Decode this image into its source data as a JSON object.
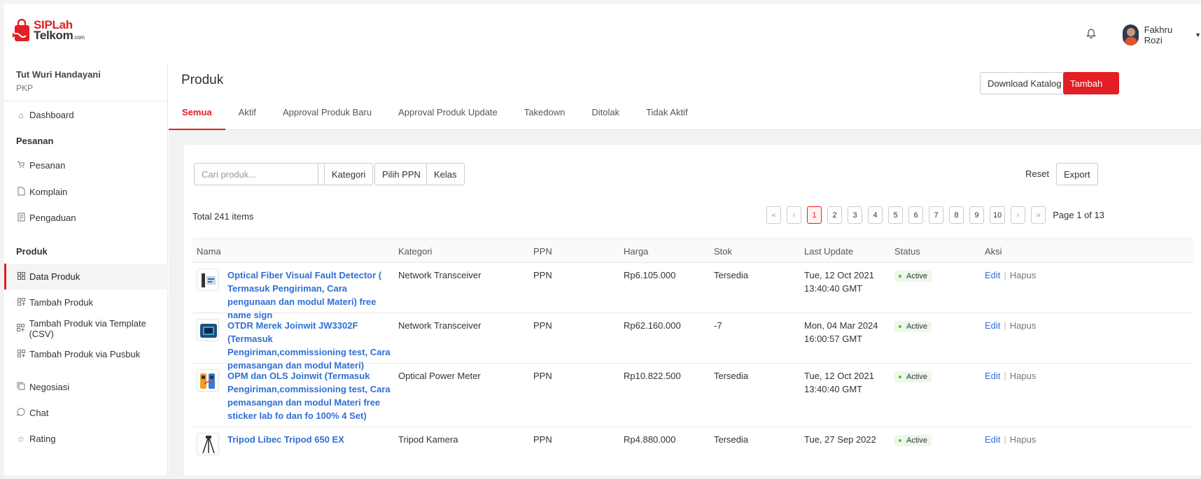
{
  "brand": {
    "line1_a": "SIPLah",
    "line2": "Telkom",
    "line2_small": ".com"
  },
  "header": {
    "user_name": "Fakhru Rozi"
  },
  "sidebar": {
    "org_name": "Tut Wuri Handayani",
    "org_type": "PKP",
    "dashboard": "Dashboard",
    "section_pesanan": "Pesanan",
    "pesanan": "Pesanan",
    "komplain": "Komplain",
    "pengaduan": "Pengaduan",
    "section_produk": "Produk",
    "data_produk": "Data Produk",
    "tambah_produk": "Tambah Produk",
    "tambah_csv": "Tambah Produk via Template (CSV)",
    "tambah_pusbuk": "Tambah Produk via Pusbuk",
    "negosiasi": "Negosiasi",
    "chat": "Chat",
    "rating": "Rating"
  },
  "page": {
    "title": "Produk",
    "download_label": "Download Katalog",
    "add_label": "Tambah",
    "tabs": [
      "Semua",
      "Aktif",
      "Approval Produk Baru",
      "Approval Produk Update",
      "Takedown",
      "Ditolak",
      "Tidak Aktif"
    ]
  },
  "filters": {
    "search_placeholder": "Cari produk...",
    "kategori": "Kategori",
    "ppn": "Pilih PPN",
    "kelas": "Kelas",
    "reset": "Reset",
    "export": "Export"
  },
  "list": {
    "total": "Total 241 items",
    "pages": [
      "«",
      "‹",
      "1",
      "2",
      "3",
      "4",
      "5",
      "6",
      "7",
      "8",
      "9",
      "10",
      "›",
      "»"
    ],
    "current_page": "1",
    "page_info": "Page 1 of 13"
  },
  "table": {
    "headers": [
      "Nama",
      "Kategori",
      "PPN",
      "Harga",
      "Stok",
      "Last Update",
      "Status",
      "Aksi"
    ],
    "edit": "Edit",
    "sep": "|",
    "delete": "Hapus",
    "rows": [
      {
        "name": "Optical Fiber Visual Fault Detector ( Termasuk Pengiriman, Cara pengunaan dan modul Materi) free name sign",
        "kategori": "Network Transceiver",
        "ppn": "PPN",
        "harga": "Rp6.105.000",
        "stok": "Tersedia",
        "update1": "Tue, 12 Oct 2021",
        "update2": "13:40:40 GMT",
        "status": "Active"
      },
      {
        "name": "OTDR Merek Joinwit JW3302F (Termasuk Pengiriman,commissioning test, Cara pemasangan dan modul Materi)",
        "kategori": "Network Transceiver",
        "ppn": "PPN",
        "harga": "Rp62.160.000",
        "stok": "-7",
        "update1": "Mon, 04 Mar 2024",
        "update2": "16:00:57 GMT",
        "status": "Active"
      },
      {
        "name": "OPM dan OLS Joinwit (Termasuk Pengiriman,commissioning test, Cara pemasangan dan modul Materi free sticker lab fo dan fo 100% 4 Set)",
        "kategori": "Optical Power Meter",
        "ppn": "PPN",
        "harga": "Rp10.822.500",
        "stok": "Tersedia",
        "update1": "Tue, 12 Oct 2021",
        "update2": "13:40:40 GMT",
        "status": "Active"
      },
      {
        "name": "Tripod Libec Tripod 650 EX",
        "kategori": "Tripod Kamera",
        "ppn": "PPN",
        "harga": "Rp4.880.000",
        "stok": "Tersedia",
        "update1": "Tue, 27 Sep 2022",
        "update2": "",
        "status": "Active"
      }
    ]
  },
  "colors": {
    "accent": "#e31e24",
    "link": "#2f6fd6",
    "status_bg": "#ecf8e8",
    "status_dot": "#52c41a"
  }
}
